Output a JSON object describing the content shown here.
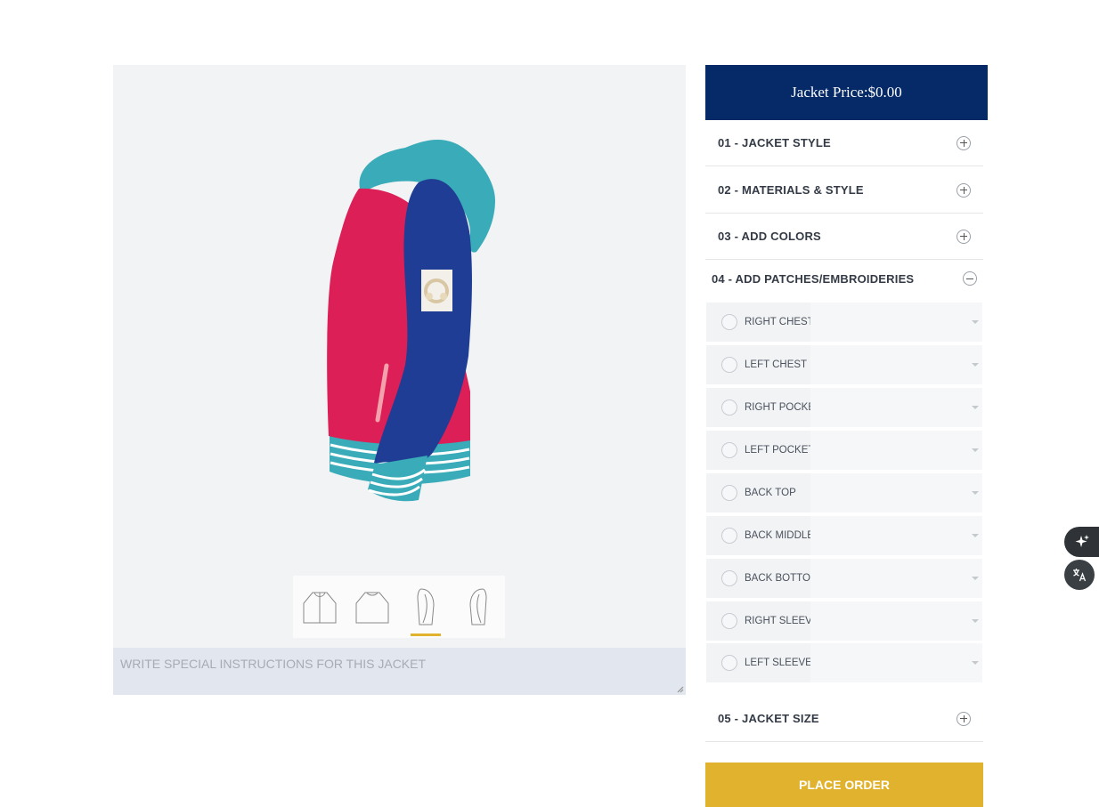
{
  "price": {
    "label": "Jacket Price:$0.00"
  },
  "instructions": {
    "placeholder": "WRITE SPECIAL INSTRUCTIONS FOR THIS JACKET"
  },
  "sections": [
    {
      "title": "01 - JACKET STYLE",
      "expanded": false
    },
    {
      "title": "02 - MATERIALS & STYLE",
      "expanded": false
    },
    {
      "title": "03 - ADD COLORS",
      "expanded": false
    },
    {
      "title": "04 - ADD PATCHES/EMBROIDERIES",
      "expanded": true
    },
    {
      "title": "05 - JACKET SIZE",
      "expanded": false
    }
  ],
  "patches": [
    "RIGHT CHEST",
    "LEFT CHEST",
    "RIGHT POCKET",
    "LEFT POCKET",
    "BACK TOP",
    "BACK MIDDLE",
    "BACK BOTTOM",
    "RIGHT SLEEVE",
    "LEFT SLEEVE"
  ],
  "thumbnails": [
    {
      "view": "front",
      "active": false
    },
    {
      "view": "back",
      "active": false
    },
    {
      "view": "left-side",
      "active": true
    },
    {
      "view": "right-side",
      "active": false
    }
  ],
  "order": {
    "label": "PLACE ORDER"
  },
  "colors": {
    "body": "#dc1f56",
    "sleeve": "#1f3d94",
    "hood": "#3aabb8",
    "trim": "#3aabb8",
    "price_bar": "#062a68",
    "order_button": "#e0b22e"
  },
  "floating": {
    "ai_icon": "sparkle-icon",
    "translate_icon": "translate-icon"
  }
}
